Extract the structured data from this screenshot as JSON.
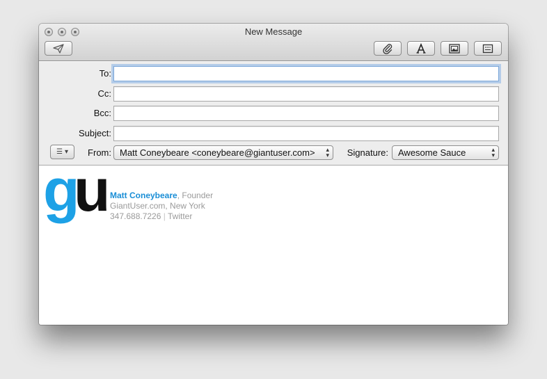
{
  "window": {
    "title": "New Message"
  },
  "toolbar": {
    "send_icon": "paper-plane-icon",
    "attach_icon": "paperclip-icon",
    "fonts_icon": "letter-a-icon",
    "photo_icon": "photo-browser-icon",
    "format_icon": "header-fields-icon"
  },
  "fields": {
    "to_label": "To:",
    "cc_label": "Cc:",
    "bcc_label": "Bcc:",
    "subject_label": "Subject:",
    "to_value": "",
    "cc_value": "",
    "bcc_value": "",
    "subject_value": ""
  },
  "from": {
    "label": "From:",
    "value": "Matt Coneybeare <coneybeare@giantuser.com>"
  },
  "signature": {
    "label": "Signature:",
    "value": "Awesome Sauce"
  },
  "action_menu": {
    "glyph": "☰",
    "arrow": "▾"
  },
  "popup_arrows": "▴▾",
  "body_signature": {
    "logo_g": "g",
    "logo_u": "u",
    "name": "Matt Coneybeare",
    "role": ", Founder",
    "line2": "GiantUser.com, New York",
    "phone": "347.688.7226",
    "sep": " | ",
    "twitter": "Twitter"
  },
  "colors": {
    "accent_blue": "#1da1e6",
    "name_blue": "#1a8ed6",
    "focus_ring": "#b5cde9"
  }
}
